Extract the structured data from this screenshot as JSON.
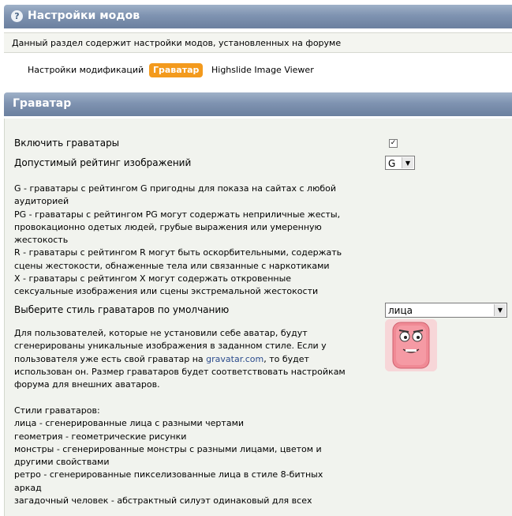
{
  "header": {
    "title": "Настройки модов",
    "help_icon": "question-circle-icon"
  },
  "description": "Данный раздел содержит настройки модов, установленных на форуме",
  "tabs": [
    {
      "label": "Настройки модификаций",
      "active": false
    },
    {
      "label": "Граватар",
      "active": true
    },
    {
      "label": "Highslide Image Viewer",
      "active": false
    }
  ],
  "section": {
    "title": "Граватар"
  },
  "settings": {
    "enable_label": "Включить граватары",
    "enable_checked": true,
    "rating_label": "Допустимый рейтинг изображений",
    "rating_value": "G",
    "rating_help": [
      "G - граватары с рейтингом G пригодны для показа на сайтах с любой аудиторией",
      "PG - граватары с рейтингом PG могут содержать неприличные жесты, провокационно одетых людей, грубые выражения или умеренную жестокость",
      "R - граватары с рейтингом R могут быть оскорбительными, содержать сцены жестокости, обнаженные тела или связанные с наркотиками",
      "X - граватары с рейтингом X могут содержать откровенные сексуальные изображения или сцены экстремальной жестокости"
    ],
    "style_label": "Выберите стиль граватаров по умолчанию",
    "style_value": "лица",
    "style_help_pre": "Для пользователей, которые не установили себе аватар, будут сгенерированы уникальные изображения в заданном стиле. Если у пользователя уже есть свой граватар на ",
    "style_help_link": "gravatar.com",
    "style_help_post": ", то будет использован он. Размер граватаров будет соответствовать настройкам форума для внешних аватаров.",
    "styles_title": "Стили граватаров:",
    "styles_list": [
      "лица - сгенерированные лица с разными чертами",
      "геометрия - геометрические рисунки",
      "монстры - сгенерированные монстры с разными лицами, цветом и другими свойствами",
      "ретро - сгенерированные пикселизованные лица в стиле 8-битных аркад",
      "загадочный человек - абстрактный силуэт одинаковый для всех"
    ]
  },
  "colors": {
    "accent": "#f39a1d",
    "header": "#7f93b1",
    "panel": "#f1f3ee",
    "link": "#2a4a8c"
  }
}
